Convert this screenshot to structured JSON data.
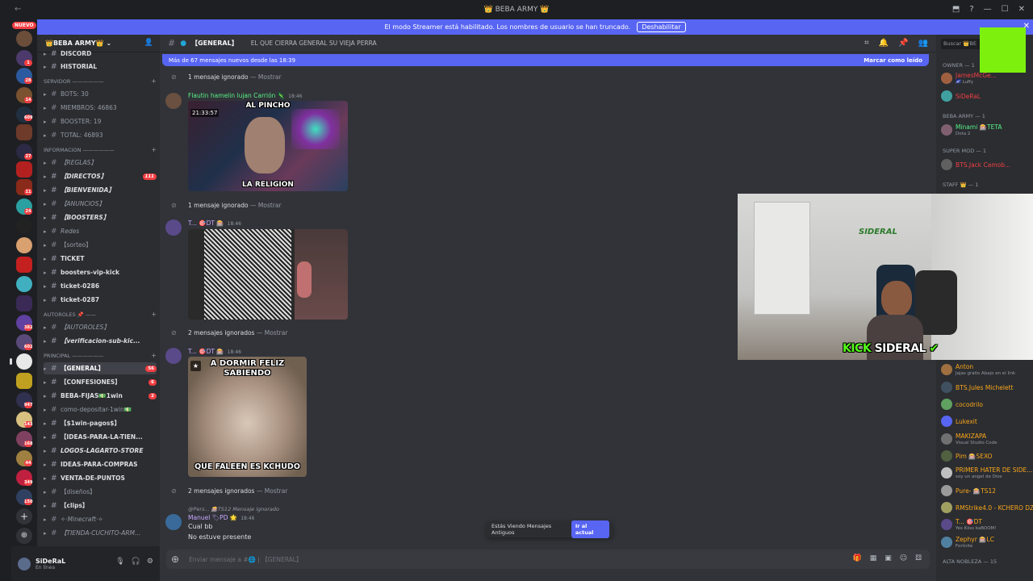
{
  "titlebar": {
    "title": "👑 BEBA ARMY 👑",
    "back": "←",
    "buttons": [
      "⬒",
      "?",
      "—",
      "☐",
      "✕"
    ]
  },
  "banner": {
    "text": "El modo Streamer está habilitado. Los nombres de usuario se han truncado.",
    "button": "Deshabilitar"
  },
  "guilds": {
    "new_badge": "NUEVO",
    "badges": [
      "1",
      "28",
      "14",
      "609",
      "27",
      "11",
      "24",
      "382",
      "602",
      "947",
      "143",
      "168",
      "44",
      "349",
      "150",
      "69"
    ]
  },
  "server": {
    "name": "👑BEBA ARMY👑"
  },
  "channels": [
    {
      "label": "DISCORD",
      "style": "bold"
    },
    {
      "label": "HISTORIAL",
      "style": "bold"
    },
    {
      "label": "SERVIDOR ——————",
      "type": "category"
    },
    {
      "label": "BOTS: 30",
      "emoji": "/"
    },
    {
      "label": "MIEMBROS: 46863",
      "emoji": "👥"
    },
    {
      "label": "BOOSTER: 19",
      "emoji": "📙"
    },
    {
      "label": "TOTAL: 46893",
      "emoji": "🗡"
    },
    {
      "label": "INFORMACION ——————",
      "type": "category"
    },
    {
      "label": "【REGLAS】",
      "style": "italic"
    },
    {
      "label": "【DIRECTOS】",
      "style": "bold italic",
      "badge": "111"
    },
    {
      "label": "【BIENVENIDA】",
      "style": "bold italic"
    },
    {
      "label": "【ANUNCIOS】",
      "style": "italic"
    },
    {
      "label": "【BOOSTERS】",
      "style": "bold italic"
    },
    {
      "label": "Redes",
      "style": "italic"
    },
    {
      "label": "【sorteo】"
    },
    {
      "label": "TICKET",
      "style": "bold"
    },
    {
      "label": "boosters-vip-kick",
      "style": "bold"
    },
    {
      "label": "ticket-0286",
      "style": "bold"
    },
    {
      "label": "ticket-0287",
      "style": "bold"
    },
    {
      "label": "AUTOROLES 📌 ——",
      "type": "category"
    },
    {
      "label": "【AUTOROLES】",
      "style": "italic"
    },
    {
      "label": "【verificacion-sub-kic...",
      "style": "bold italic"
    },
    {
      "label": "PRINCIPAL ——————",
      "type": "category"
    },
    {
      "label": "【GENERAL】",
      "style": "bold",
      "badge": "56",
      "active": true
    },
    {
      "label": "【CONFESIONES】",
      "style": "bold",
      "badge": "6"
    },
    {
      "label": "BEBA-FIJAS💵1win",
      "style": "bold",
      "badge": "2"
    },
    {
      "label": "como-depositar-1win💵"
    },
    {
      "label": "【$1win-pagos$】",
      "style": "bold"
    },
    {
      "label": "【IDEAS-PARA-LA-TIEN...",
      "style": "bold"
    },
    {
      "label": "LOGOS-LAGARTO-STORE",
      "style": "bold italic"
    },
    {
      "label": "IDEAS-PARA-COMPRAS",
      "style": "bold"
    },
    {
      "label": "VENTA-DE-PUNTOS",
      "style": "bold"
    },
    {
      "label": "【diseños】"
    },
    {
      "label": "【clips】",
      "style": "bold"
    },
    {
      "label": "✧·Minecraft·✧",
      "style": "italic"
    },
    {
      "label": "【TIENDA-CUCHITO-ARM...",
      "style": "italic"
    }
  ],
  "user": {
    "name": "SiDeRaL",
    "status": "En línea"
  },
  "channel_header": {
    "name": "【GENERAL】",
    "topic": "EL QUE CIERRA GENERAL SU VIEJA PERRA"
  },
  "new_messages": {
    "text": "Más de 67 mensajes nuevos desde las 18:39",
    "mark": "Marcar como leído"
  },
  "messages": {
    "ignored1": {
      "text": "1 mensaje ignorado",
      "sep": " — ",
      "show": "Mostrar"
    },
    "m1": {
      "author": "Flautin hamelin lujan Carrión 🦎",
      "time": "18:46",
      "timer": "21:33:57",
      "top": "AL PINCHO",
      "bottom": "LA RELIGION"
    },
    "ignored2": {
      "text": "1 mensaje ignorado",
      "sep": " — ",
      "show": "Mostrar"
    },
    "m2": {
      "author": "T... 🎯DT 🎰",
      "time": "18:46"
    },
    "ignored3": {
      "text": "2 mensajes ignorados",
      "sep": " — ",
      "show": "Mostrar"
    },
    "m3": {
      "author": "T... 🎯DT 🎰",
      "time": "18:46",
      "top": "A DORMIR FELIZ SABIENDO",
      "bottom": "QUE FALEEN ES KCHUDO"
    },
    "ignored4": {
      "text": "2 mensajes ignorados",
      "sep": " — ",
      "show": "Mostrar"
    },
    "m4": {
      "reply": "@Pers... 🎰TS12 Mensaje ignorado",
      "author": "Manuel 🏷PD 🌟",
      "time": "18:46",
      "line1": "Cual bb",
      "line2": "No estuve presente"
    }
  },
  "old_messages": {
    "text": "Estás Viendo Mensajes Antiguos",
    "button": "Ir al actual"
  },
  "composer": {
    "placeholder": "Enviar mensaje a #🌐 | 【GENERAL】"
  },
  "members": {
    "search": "Buscar 👑BE",
    "owner_cat": "OWNER — 1",
    "beba_cat": "BEBA ARMY — 1",
    "super_cat": "SUPER MOD — 1",
    "staff_cat": "STAFF 👑 — 1",
    "noble_cat": "ALTA NOBLEZA — 15",
    "list": [
      {
        "name": "JamesMcGe...",
        "sub": "🌌 Luffy",
        "color": "#f23f43"
      },
      {
        "name": "SiDeRaL",
        "sub": "",
        "color": "#f23f43"
      },
      {
        "name": "Minami 🎰TETA",
        "sub": "Dota 2",
        "color": "#57f287"
      },
      {
        "name": "BTS.Jack Camob...",
        "sub": "",
        "color": "#f23f43"
      },
      {
        "name": "Anton",
        "sub": "Jajas gratis Abajo en el link",
        "color": "#faa61a"
      },
      {
        "name": "BTS.Jules Michelett",
        "sub": "",
        "color": "#faa61a"
      },
      {
        "name": "cocodrilo",
        "sub": "",
        "color": "#faa61a"
      },
      {
        "name": "Lukexit",
        "sub": "",
        "color": "#faa61a"
      },
      {
        "name": "MAKIZAPA",
        "sub": "Visual Studio Code",
        "color": "#faa61a"
      },
      {
        "name": "Pim 🎰SEXO",
        "sub": "",
        "color": "#faa61a"
      },
      {
        "name": "PRIMER HATER DE SIDE...",
        "sub": "soy un angel de Dios",
        "color": "#faa61a"
      },
      {
        "name": "Pure- 🎰TS12",
        "sub": "",
        "color": "#faa61a"
      },
      {
        "name": "RMStrike4.0 - KCHERO DZ",
        "sub": "",
        "color": "#faa61a"
      },
      {
        "name": "T... 🎯DT",
        "sub": "Yes Kiiss kaBOOM!",
        "color": "#faa61a"
      },
      {
        "name": "Zephyr 🎰LC",
        "sub": "Fortnite",
        "color": "#faa61a"
      }
    ]
  },
  "webcam": {
    "kick": "KICK",
    "sideral": "SIDERAL",
    "wall_logo": "SIDERAL"
  }
}
